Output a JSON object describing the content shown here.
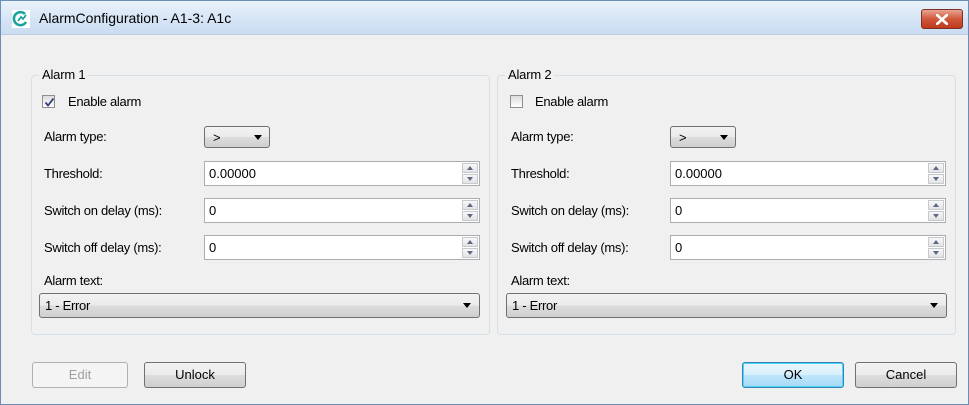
{
  "window": {
    "title": "AlarmConfiguration - A1-3: A1c"
  },
  "alarm1": {
    "legend": "Alarm 1",
    "enable_label": "Enable alarm",
    "enable_checked": true,
    "alarm_type_label": "Alarm type:",
    "alarm_type_value": ">",
    "threshold_label": "Threshold:",
    "threshold_value": "0.00000",
    "switch_on_label": "Switch on delay (ms):",
    "switch_on_value": "0",
    "switch_off_label": "Switch off delay (ms):",
    "switch_off_value": "0",
    "alarm_text_label": "Alarm text:",
    "alarm_text_value": "1 - Error"
  },
  "alarm2": {
    "legend": "Alarm 2",
    "enable_label": "Enable alarm",
    "enable_checked": false,
    "alarm_type_label": "Alarm type:",
    "alarm_type_value": ">",
    "threshold_label": "Threshold:",
    "threshold_value": "0.00000",
    "switch_on_label": "Switch on delay (ms):",
    "switch_on_value": "0",
    "switch_off_label": "Switch off delay (ms):",
    "switch_off_value": "0",
    "alarm_text_label": "Alarm text:",
    "alarm_text_value": "1 - Error"
  },
  "buttons": {
    "edit": "Edit",
    "unlock": "Unlock",
    "ok": "OK",
    "cancel": "Cancel"
  },
  "colors": {
    "close_button": "#c7432a",
    "app_icon": "#1aa39a",
    "default_button_border": "#3c7fb1"
  },
  "icons": {
    "app": "app-logo-icon",
    "close": "close-icon",
    "check": "checkmark-icon",
    "dropdown": "chevron-down-icon",
    "spin_up": "spin-up-icon",
    "spin_down": "spin-down-icon"
  }
}
